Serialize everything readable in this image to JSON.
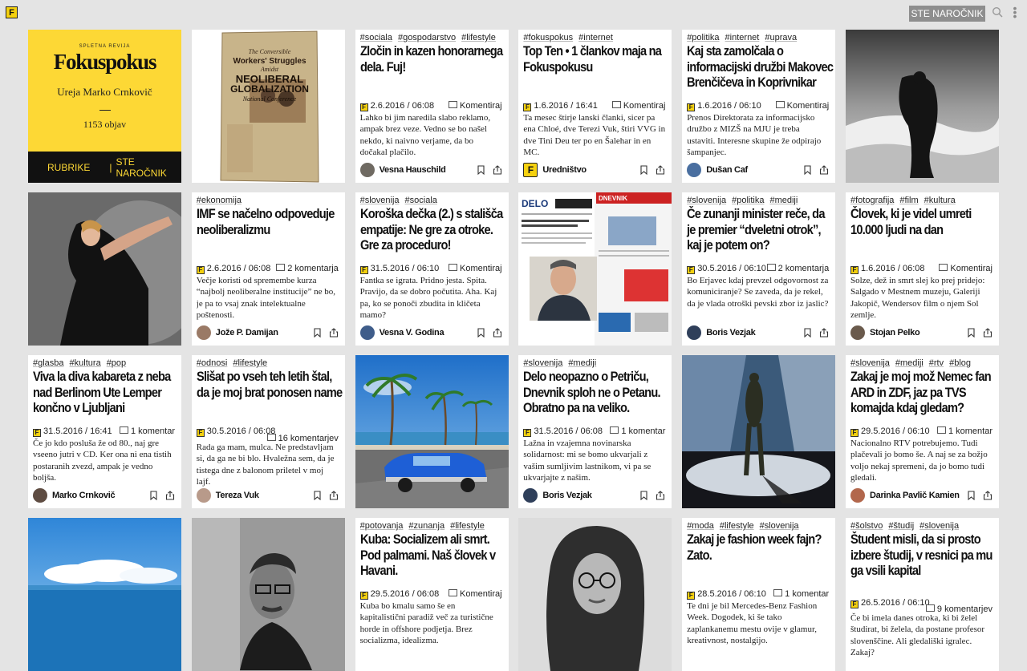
{
  "topbar": {
    "logo_letter": "F",
    "subscribe": "STE NAROČNIK"
  },
  "brand": {
    "mini": "SPLETNA REVIJA",
    "name": "Fokuspokus",
    "editor": "Ureja Marko Crnkovič",
    "dash": "—",
    "count": "1153 objav",
    "rubrike": "RUBRIKE",
    "sep": "|",
    "subscribe": "STE NAROČNIK"
  },
  "articles": [
    {
      "tags": [
        "#sociala",
        "#gospodarstvo",
        "#lifestyle"
      ],
      "title": "Zločin in kazen honorarnega dela. Fuj!",
      "date": "2.6.2016 / 06:08",
      "comments": "Komentiraj",
      "excerpt": "Lahko bi jim naredila slabo reklamo, ampak brez veze. Vedno se bo našel nekdo, ki naivno verjame, da bo dočakal plačilo.",
      "author": "Vesna Hauschild"
    },
    {
      "tags": [
        "#fokuspokus",
        "#internet"
      ],
      "title": "Top Ten • 1 člankov maja na Fokuspokusu",
      "date": "1.6.2016 / 16:41",
      "comments": "Komentiraj",
      "excerpt": "Ta mesec štirje lanski članki, sicer pa ena Chloé, dve Terezi Vuk, štiri VVG in dve Tini Deu ter po en Šalehar in en MC.",
      "author": "Uredništvo"
    },
    {
      "tags": [
        "#politika",
        "#internet",
        "#uprava"
      ],
      "title": "Kaj sta zamolčala o informacijski družbi Makovec Brenčičeva in Koprivnikar",
      "date": "1.6.2016 / 06:10",
      "comments": "Komentiraj",
      "excerpt": "Prenos Direktorata za informacijsko družbo z MIZŠ na MJU je treba ustaviti. Interesne skupine že odpirajo šampanjec.",
      "author": "Dušan Caf"
    },
    {
      "tags": [
        "#ekonomija"
      ],
      "title": "IMF se načelno odpoveduje neoliberalizmu",
      "date": "2.6.2016 / 06:08",
      "comments": "2 komentarja",
      "excerpt": "Večje koristi od spremembe kurza “najbolj neoliberalne institucije” ne bo, je pa to vsaj znak intelektualne poštenosti.",
      "author": "Jože P. Damijan"
    },
    {
      "tags": [
        "#slovenija",
        "#sociala"
      ],
      "title": "Koroška dečka (2.) s stališča empatije: Ne gre za otroke. Gre za proceduro!",
      "date": "31.5.2016 / 06:10",
      "comments": "Komentiraj",
      "excerpt": "Fantka se igrata. Pridno jesta. Spita. Pravijo, da se dobro počutita. Aha. Kaj pa, ko se ponoči zbudita in kličeta mamo?",
      "author": "Vesna V. Godina"
    },
    {
      "tags": [
        "#slovenija",
        "#politika",
        "#mediji"
      ],
      "title": "Če zunanji minister reče, da je premier “dveletni otrok”, kaj je potem on?",
      "date": "30.5.2016 / 06:10",
      "comments": "2 komentarja",
      "excerpt": "Bo Erjavec kdaj prevzel odgovornost za komuniciranje? Se zaveda, da je rekel, da je vlada otroški pevski zbor iz jaslic?",
      "author": "Boris Vezjak"
    },
    {
      "tags": [
        "#fotografija",
        "#film",
        "#kultura"
      ],
      "title": "Človek, ki je videl umreti 10.000 ljudi na dan",
      "date": "1.6.2016 / 06:08",
      "comments": "Komentiraj",
      "excerpt": "Solze, dež in smrt slej ko prej pridejo: Salgado v Mestnem muzeju, Galeriji Jakopič, Wendersov film o njem Sol zemlje.",
      "author": "Stojan Pelko"
    },
    {
      "tags": [
        "#glasba",
        "#kultura",
        "#pop"
      ],
      "title": "Viva la diva kabareta z neba nad Berlinom Ute Lemper končno v Ljubljani",
      "date": "31.5.2016 / 16:41",
      "comments": "1 komentar",
      "excerpt": "Če jo kdo posluša že od 80., naj gre vseeno jutri v CD. Ker ona ni ena tistih postaranih zvezd, ampak je vedno boljša.",
      "author": "Marko Crnkovič"
    },
    {
      "tags": [
        "#odnosi",
        "#lifestyle"
      ],
      "title": "Slišat po vseh teh letih štal, da je moj brat ponosen name",
      "date": "30.5.2016 / 06:08",
      "comments": "16 komentarjev",
      "excerpt": "Rada ga mam, mulca. Ne predstavljam si, da ga ne bi blo. Hvaležna sem, da je tistega dne z balonom priletel v moj lajf.",
      "author": "Tereza Vuk"
    },
    {
      "tags": [
        "#slovenija",
        "#mediji"
      ],
      "title": "Delo neopazno o Petriču, Dnevnik sploh ne o Petanu. Obratno pa na veliko.",
      "date": "31.5.2016 / 06:08",
      "comments": "1 komentar",
      "excerpt": "Lažna in vzajemna novinarska solidarnost: mi se bomo ukvarjali z vašim sumljivim lastnikom, vi pa se ukvarjajte z našim.",
      "author": "Boris Vezjak"
    },
    {
      "tags": [
        "#slovenija",
        "#mediji",
        "#rtv",
        "#blog"
      ],
      "title": "Zakaj je moj mož Nemec fan ARD in ZDF, jaz pa TVS komajda kdaj gledam?",
      "date": "29.5.2016 / 06:10",
      "comments": "1 komentar",
      "excerpt": "Nacionalno RTV potrebujemo. Tudi plačevali jo bomo še. A naj se za božjo voljo nekaj spremeni, da jo bomo tudi gledali.",
      "author": "Darinka Pavlič Kamien"
    },
    {
      "tags": [
        "#potovanja",
        "#zunanja",
        "#lifestyle"
      ],
      "title": "Kuba: Socializem ali smrt. Pod palmami. Naš človek v Havani.",
      "date": "29.5.2016 / 06:08",
      "comments": "Komentiraj",
      "excerpt": "Kuba bo kmalu samo še en kapitalistični paradiž več za turistične horde in offshore podjetja. Brez socializma, idealizma.",
      "author": ""
    },
    {
      "tags": [
        "#moda",
        "#lifestyle",
        "#slovenija"
      ],
      "title": "Zakaj je fashion week fajn? Zato.",
      "date": "28.5.2016 / 06:10",
      "comments": "1 komentar",
      "excerpt": "Te dni je bil Mercedes-Benz Fashion Week. Dogodek, ki še tako zaplankanemu mestu ovije v glamur, kreativnost, nostalgijo.",
      "author": ""
    },
    {
      "tags": [
        "#šolstvo",
        "#študij",
        "#slovenija"
      ],
      "title": "Študent misli, da si prosto izbere študij, v resnici pa mu ga vsili kapital",
      "date": "26.5.2016 / 06:10",
      "comments": "9 komentarjev",
      "excerpt": "Če bi imela danes otroka, ki bi želel študirat, bi želela, da postane profesor slovenščine. Ali gledališki igralec. Zakaj?",
      "author": ""
    }
  ],
  "poster": {
    "line1": "Workers' Struggles",
    "line2": "Amidst",
    "line3": "NEOLIBERAL",
    "line4": "GLOBALIZATION",
    "line5": "National Conference"
  },
  "screenshot_text": {
    "paper": "DELO",
    "mid": "DNEVNIK"
  }
}
